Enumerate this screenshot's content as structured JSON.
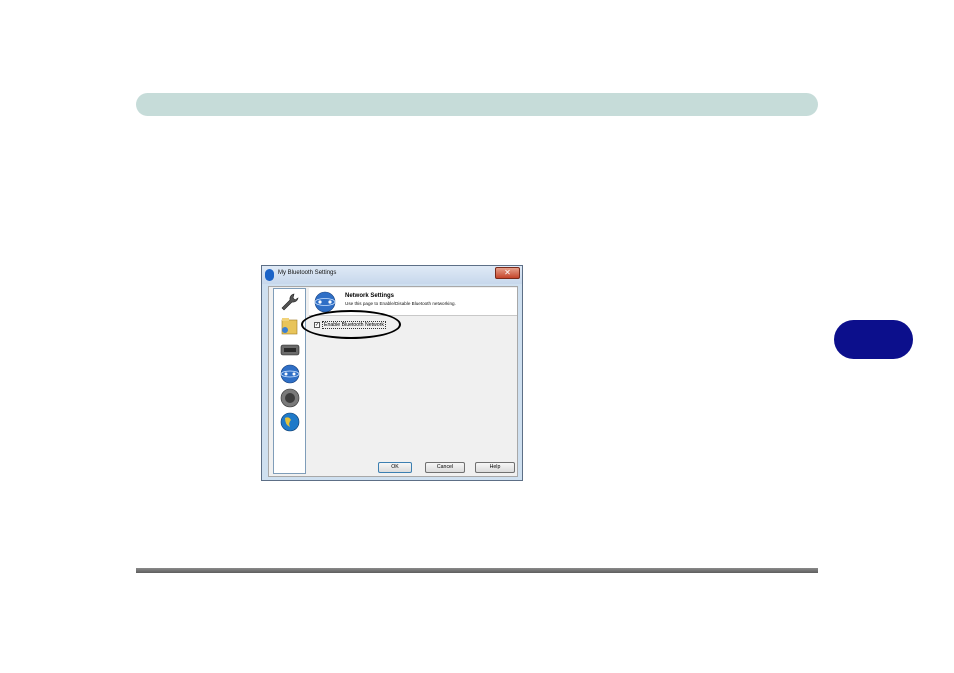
{
  "dialog": {
    "title": "My Bluetooth Settings",
    "close_glyph": "✕",
    "nav_items": [
      {
        "icon": "wrench-icon"
      },
      {
        "icon": "folder-share-icon"
      },
      {
        "icon": "serial-port-icon"
      },
      {
        "icon": "network-globe-icon"
      },
      {
        "icon": "speaker-icon"
      },
      {
        "icon": "globe-icon"
      }
    ],
    "header": {
      "title": "Network Settings",
      "description": "Use this page to Enable/Disable Bluetooth networking.",
      "icon": "network-globe-icon"
    },
    "checkbox": {
      "label": "Enable Bluetooth Network",
      "checked": true,
      "check_glyph": "✓"
    },
    "buttons": {
      "ok": "OK",
      "cancel": "Cancel",
      "help": "Help"
    }
  },
  "colors": {
    "top_bar": "#c6dcd9",
    "side_tab": "#0c0f8c",
    "bottom_rule": "#6e6e6e"
  }
}
